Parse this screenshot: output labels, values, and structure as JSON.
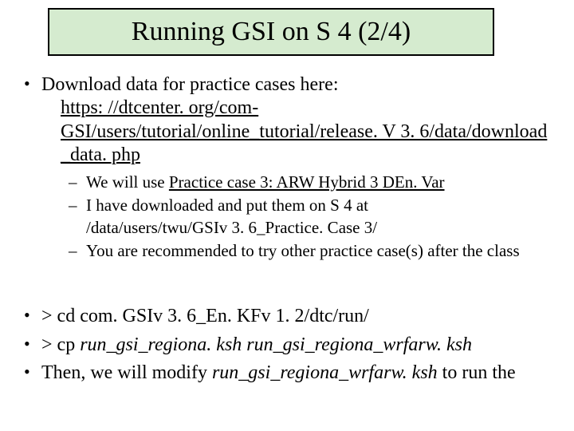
{
  "title": "Running GSI on S 4 (2/4)",
  "bullets": {
    "b1": {
      "lead": "Download data for practice cases here:",
      "url_line1": "https: //dtcenter. org/com-",
      "url_line2": "GSI/users/tutorial/online_tutorial/release. V 3. 6/data/download",
      "url_line3": "_data. php"
    },
    "sub": {
      "s1_a": "We will use ",
      "s1_b": "Practice case 3: ARW Hybrid 3 DEn. Var",
      "s2_a": "I have downloaded and put them on S 4 at",
      "s2_b": "/data/users/twu/GSIv 3. 6_Practice. Case 3/",
      "s3": "You are recommended to try other practice case(s) after the class"
    },
    "b2": "> cd com. GSIv 3. 6_En. KFv 1. 2/dtc/run/",
    "b3_a": "> cp ",
    "b3_b": "run_gsi_regiona. ksh run_gsi_regiona_wrfarw. ksh",
    "b4_a": "Then, we will modify ",
    "b4_b": "run_gsi_regiona_wrfarw. ksh",
    "b4_c": " to run the"
  }
}
